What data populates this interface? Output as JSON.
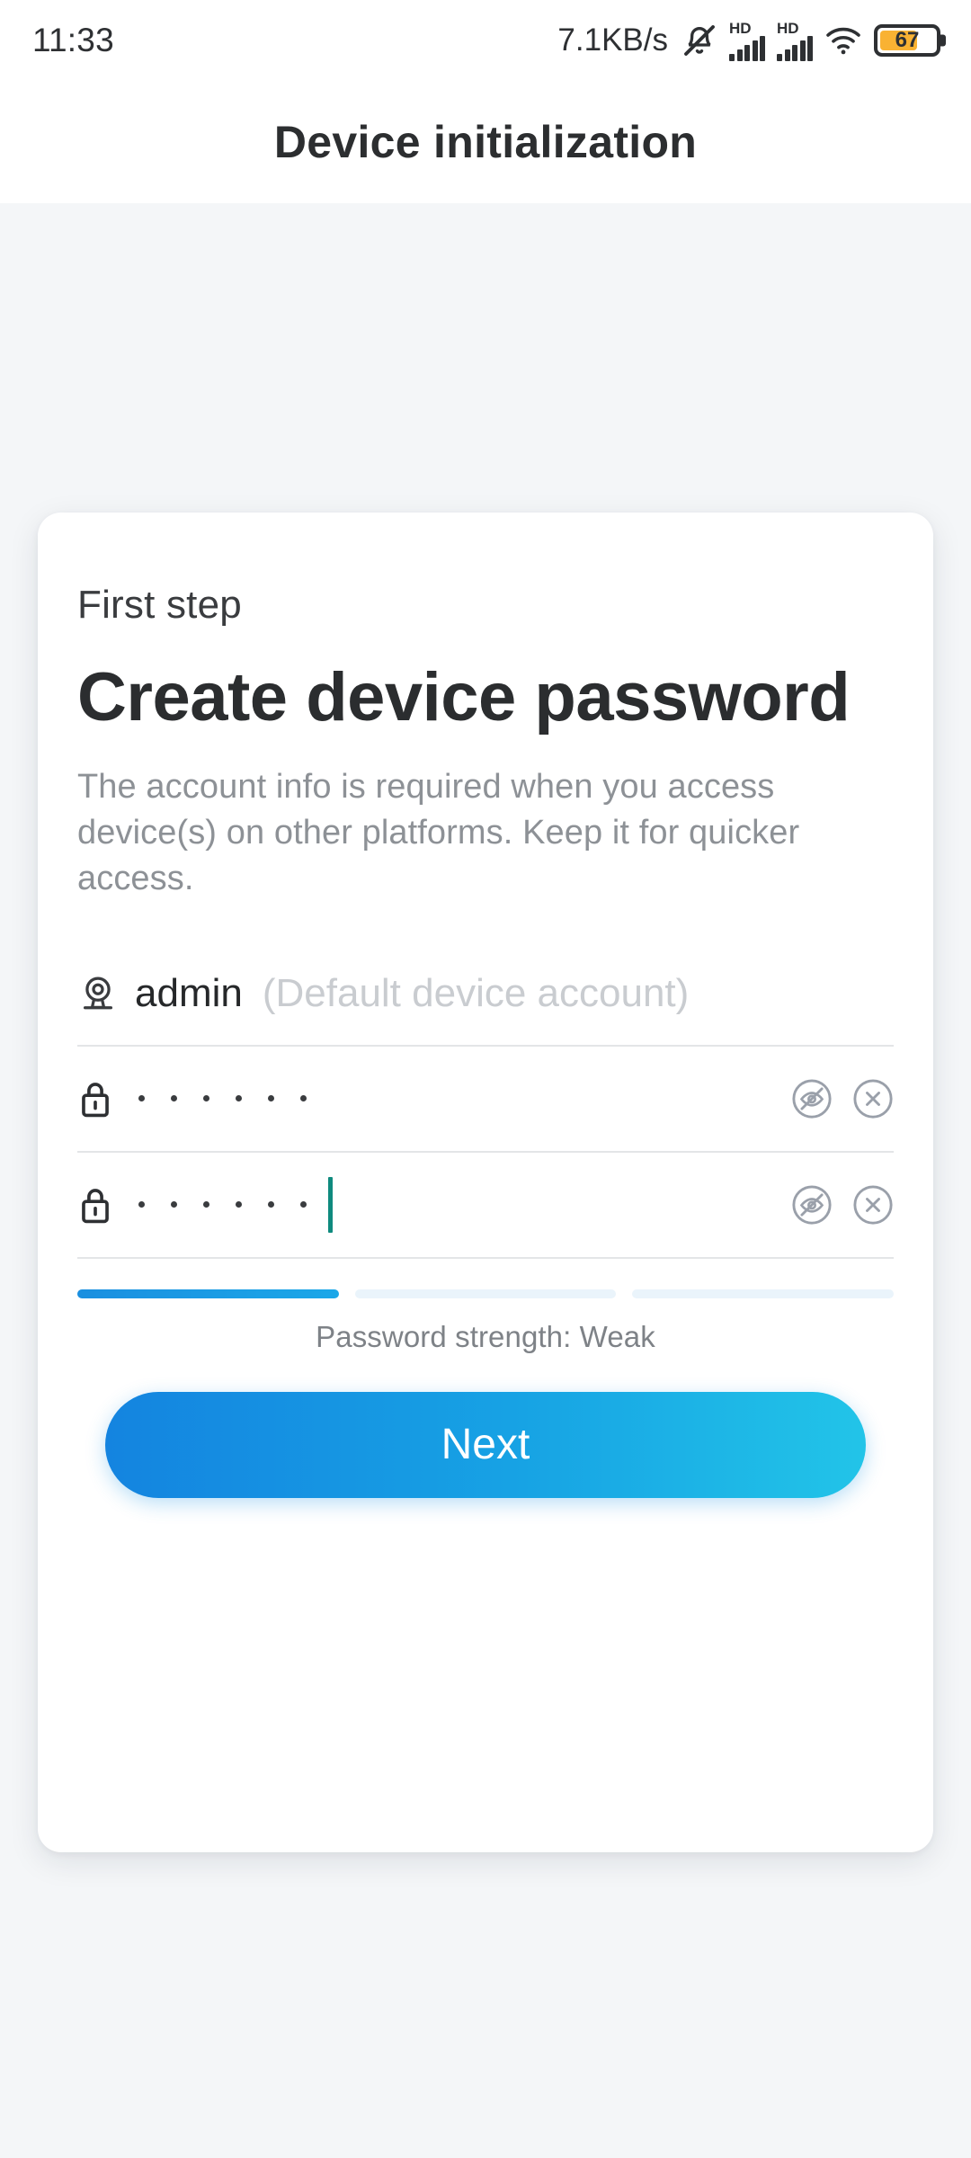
{
  "status_bar": {
    "time": "11:33",
    "net_speed": "7.1KB/s",
    "icons": [
      "mute-bell-icon",
      "signal-hd-1-icon",
      "signal-hd-2-icon",
      "wifi-icon",
      "battery-icon"
    ],
    "hd_label_1": "HD",
    "hd_label_2": "HD",
    "battery_percent": "67",
    "battery_fill_color": "#f9b233"
  },
  "header": {
    "title": "Device initialization"
  },
  "card": {
    "step_label": "First step",
    "title": "Create device password",
    "description": "The account info is required when you access device(s) on other platforms. Keep it for quicker access.",
    "username_field": {
      "icon": "camera-device-icon",
      "value": "admin",
      "hint": "(Default device account)"
    },
    "password_field": {
      "icon": "lock-icon",
      "masked_value": "······",
      "dot_count": 6,
      "toggle_icon": "eye-off-icon",
      "clear_icon": "close-circle-icon"
    },
    "confirm_password_field": {
      "icon": "lock-icon",
      "masked_value": "······",
      "dot_count": 6,
      "toggle_icon": "eye-off-icon",
      "clear_icon": "close-circle-icon",
      "caret_color": "#0f8a7e",
      "focused": true
    },
    "password_strength": {
      "label": "Password strength: Weak",
      "segments_total": 3,
      "segments_filled": 1,
      "filled_color": "#1a8fe0",
      "empty_color": "#eaf4fb"
    },
    "next_button": {
      "label": "Next",
      "gradient_from": "#1484e0",
      "gradient_to": "#22c4e8"
    }
  }
}
